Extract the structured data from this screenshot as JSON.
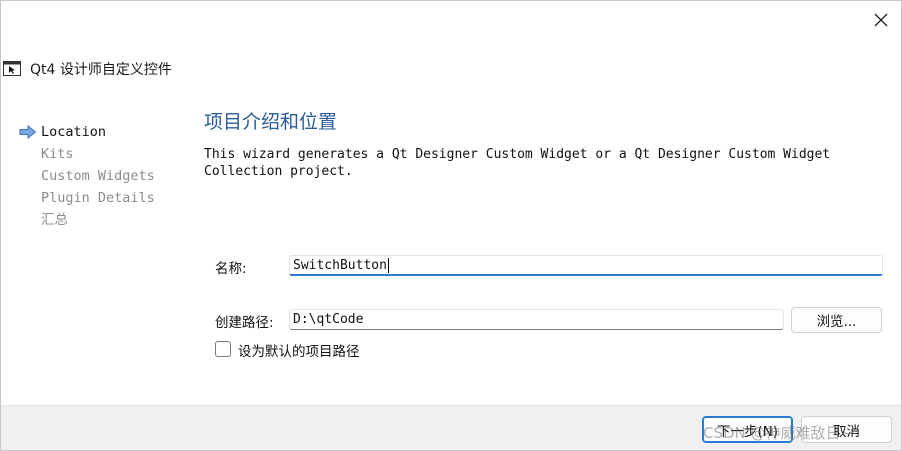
{
  "window": {
    "title": "Qt4 设计师自定义控件",
    "close_glyph": "✕"
  },
  "steps": [
    {
      "label": "Location",
      "current": true
    },
    {
      "label": "Kits",
      "current": false
    },
    {
      "label": "Custom Widgets",
      "current": false
    },
    {
      "label": "Plugin Details",
      "current": false
    },
    {
      "label": "汇总",
      "current": false
    }
  ],
  "page": {
    "title": "项目介绍和位置",
    "description": "This wizard generates a Qt Designer Custom Widget or a Qt Designer Custom Widget Collection project."
  },
  "form": {
    "name_label": "名称:",
    "name_value": "SwitchButton",
    "path_label": "创建路径:",
    "path_value": "D:\\qtCode",
    "browse_label": "浏览...",
    "default_path_label": "设为默认的项目路径",
    "default_path_checked": false
  },
  "footer": {
    "next_label": "下一步(N)",
    "cancel_label": "取消"
  },
  "watermark": "CSDN @神威难敌日~",
  "colors": {
    "accent": "#2a7bd4",
    "page_title": "#2a5d9a",
    "inactive_step": "#8c8c8c"
  }
}
